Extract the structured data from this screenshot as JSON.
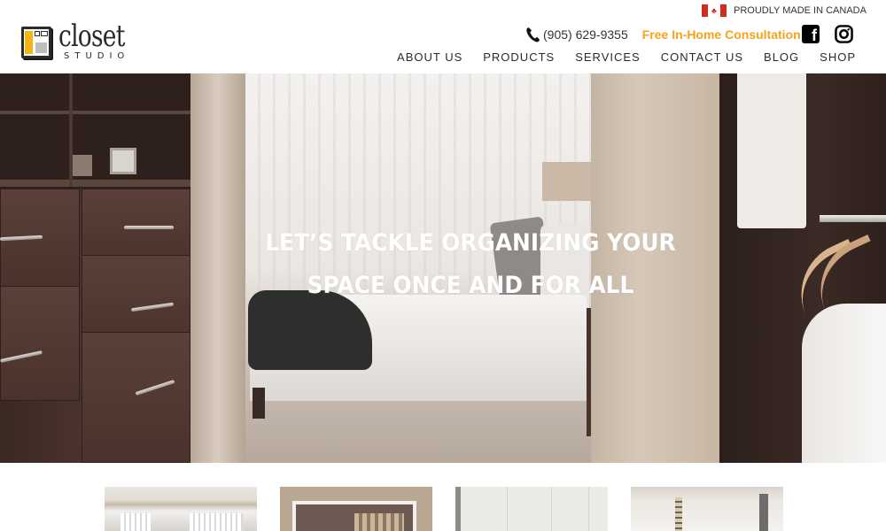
{
  "header": {
    "logo": {
      "word": "closet",
      "subword": "STUDIO"
    },
    "made_in": "PROUDLY MADE IN CANADA",
    "phone": "(905) 629-9355",
    "consultation": "Free In-Home Consultation",
    "social": [
      {
        "name": "facebook",
        "glyph": "f"
      },
      {
        "name": "instagram"
      }
    ],
    "nav": [
      {
        "label": "ABOUT US"
      },
      {
        "label": "PRODUCTS"
      },
      {
        "label": "SERVICES"
      },
      {
        "label": "CONTACT US"
      },
      {
        "label": "BLOG"
      },
      {
        "label": "SHOP"
      }
    ]
  },
  "hero": {
    "headline_line1": "LET’S TACKLE ORGANIZING YOUR",
    "headline_line2": "SPACE ONCE AND FOR ALL"
  },
  "colors": {
    "accent": "#f5a31a",
    "logo_yellow": "#f5b316",
    "text_dark": "#2b2b2b",
    "canada_red": "#d52b1e"
  },
  "thumbnails": [
    {
      "subject": "white walk-in closet with shirts"
    },
    {
      "subject": "reach-in closet with dark wood"
    },
    {
      "subject": "white wardrobe doors"
    },
    {
      "subject": "closet with pendant lights"
    }
  ]
}
